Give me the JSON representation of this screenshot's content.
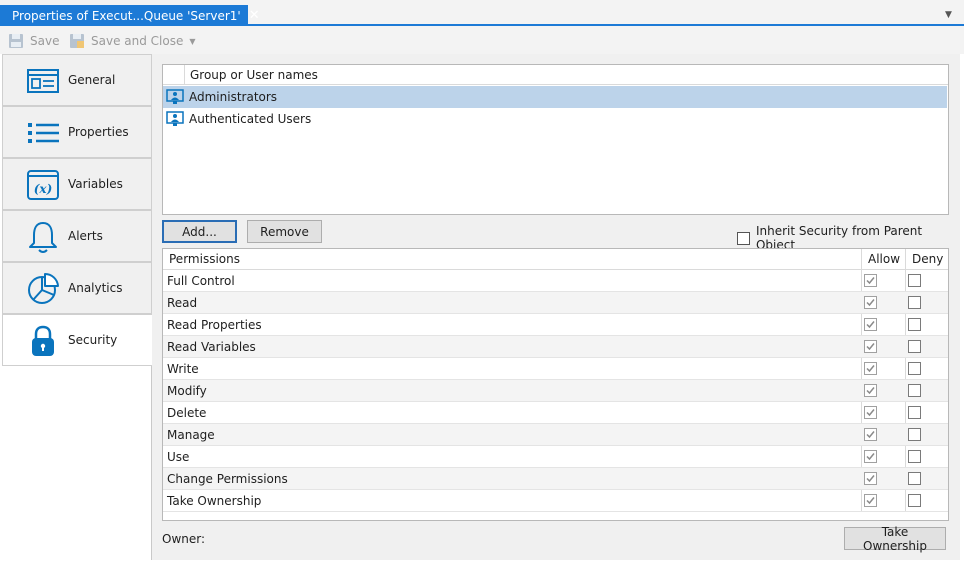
{
  "tab": {
    "title": "Properties of Execut...Queue 'Server1'",
    "close": "✕"
  },
  "toolbar": {
    "save_label": "Save",
    "save_close_label": "Save and Close"
  },
  "nav": {
    "items": [
      {
        "label": "General",
        "icon": "general-icon"
      },
      {
        "label": "Properties",
        "icon": "list-icon"
      },
      {
        "label": "Variables",
        "icon": "variables-icon"
      },
      {
        "label": "Alerts",
        "icon": "bell-icon"
      },
      {
        "label": "Analytics",
        "icon": "pie-chart-icon"
      },
      {
        "label": "Security",
        "icon": "lock-icon"
      }
    ],
    "active": "Security"
  },
  "users": {
    "header": "Group or User names",
    "rows": [
      "Administrators",
      "Authenticated Users"
    ],
    "selected": "Administrators"
  },
  "buttons": {
    "add": "Add...",
    "remove": "Remove",
    "take_ownership": "Take Ownership"
  },
  "inherit": {
    "label": "Inherit Security from Parent Object",
    "checked": false
  },
  "permissions": {
    "headers": {
      "name": "Permissions",
      "allow": "Allow",
      "deny": "Deny"
    },
    "rows": [
      {
        "name": "Full Control",
        "allow": true,
        "deny": false
      },
      {
        "name": "Read",
        "allow": true,
        "deny": false
      },
      {
        "name": "Read Properties",
        "allow": true,
        "deny": false
      },
      {
        "name": "Read Variables",
        "allow": true,
        "deny": false
      },
      {
        "name": "Write",
        "allow": true,
        "deny": false
      },
      {
        "name": "Modify",
        "allow": true,
        "deny": false
      },
      {
        "name": "Delete",
        "allow": true,
        "deny": false
      },
      {
        "name": "Manage",
        "allow": true,
        "deny": false
      },
      {
        "name": "Use",
        "allow": true,
        "deny": false
      },
      {
        "name": "Change Permissions",
        "allow": true,
        "deny": false
      },
      {
        "name": "Take Ownership",
        "allow": true,
        "deny": false
      }
    ]
  },
  "owner": {
    "label": "Owner:"
  },
  "colors": {
    "accent": "#1c7ad6",
    "selection": "#bcd3ea",
    "icon_blue": "#0a74bd"
  }
}
